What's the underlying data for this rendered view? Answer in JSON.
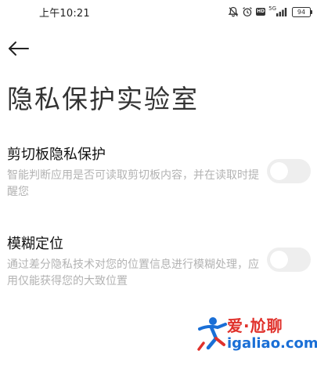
{
  "status_bar": {
    "time": "上午10:21",
    "network_label": "5G",
    "battery_level": "94",
    "icons": [
      "mute-icon",
      "alarm-icon",
      "hd-icon",
      "signal-icon",
      "battery-icon"
    ]
  },
  "nav": {
    "back_icon": "back-arrow-icon"
  },
  "page": {
    "title": "隐私保护实验室"
  },
  "settings": [
    {
      "title": "剪切板隐私保护",
      "description": "智能判断应用是否可读取剪切板内容，并在读取时提醒您",
      "enabled": false
    },
    {
      "title": "模糊定位",
      "description": "通过差分隐私技术对您的位置信息进行模糊处理，应用仅能获得您的大致位置",
      "enabled": false
    }
  ],
  "watermark": {
    "text_top": "爱·尬聊",
    "text_bottom": "igaliao.com"
  },
  "colors": {
    "background": "#ffffff",
    "title_text": "#333333",
    "item_title": "#111111",
    "description": "#b3b3b3",
    "toggle_off_track": "#eeeeee",
    "watermark_blue": "#1a6fd6",
    "watermark_red": "#e0312b"
  }
}
